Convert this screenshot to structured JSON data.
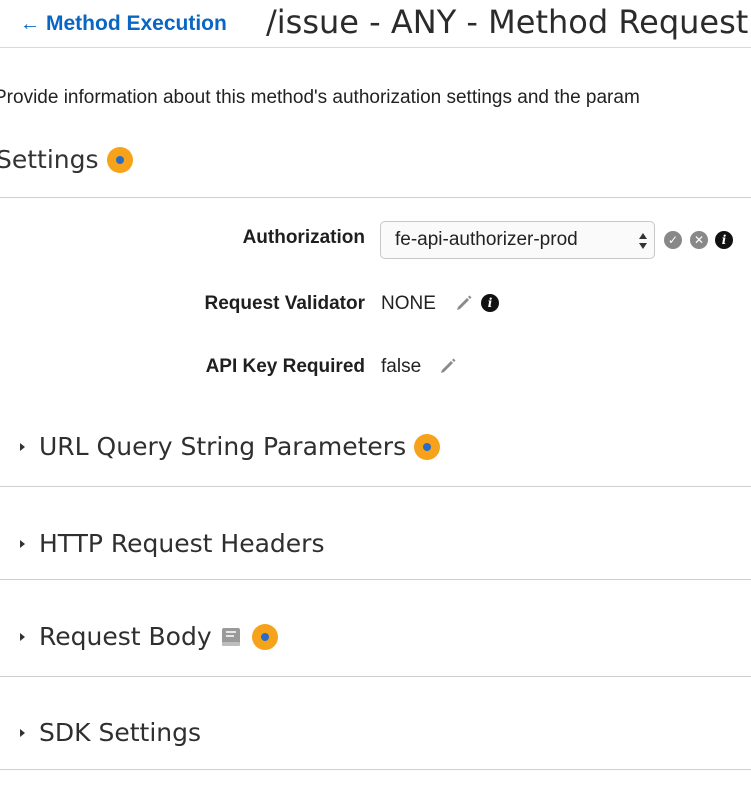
{
  "header": {
    "back_label": "Method Execution",
    "title": "/issue - ANY - Method Request"
  },
  "description": "Provide information about this method's authorization settings and the param",
  "settings": {
    "title": "Settings",
    "authorization": {
      "label": "Authorization",
      "value": "fe-api-authorizer-prod"
    },
    "request_validator": {
      "label": "Request Validator",
      "value": "NONE"
    },
    "api_key_required": {
      "label": "API Key Required",
      "value": "false"
    }
  },
  "sections": {
    "url_query": "URL Query String Parameters",
    "http_headers": "HTTP Request Headers",
    "request_body": "Request Body",
    "sdk_settings": "SDK Settings"
  },
  "colors": {
    "link": "#0a66c2",
    "badge": "#f7a21b",
    "badge_center": "#2a6bc6"
  },
  "icons": {
    "back": "arrow-left-icon",
    "badge": "info-dot-icon",
    "confirm": "check-circle-icon",
    "cancel": "x-circle-icon",
    "info": "info-circle-icon",
    "edit": "pencil-icon",
    "model": "book-icon",
    "expand": "caret-right-icon"
  }
}
